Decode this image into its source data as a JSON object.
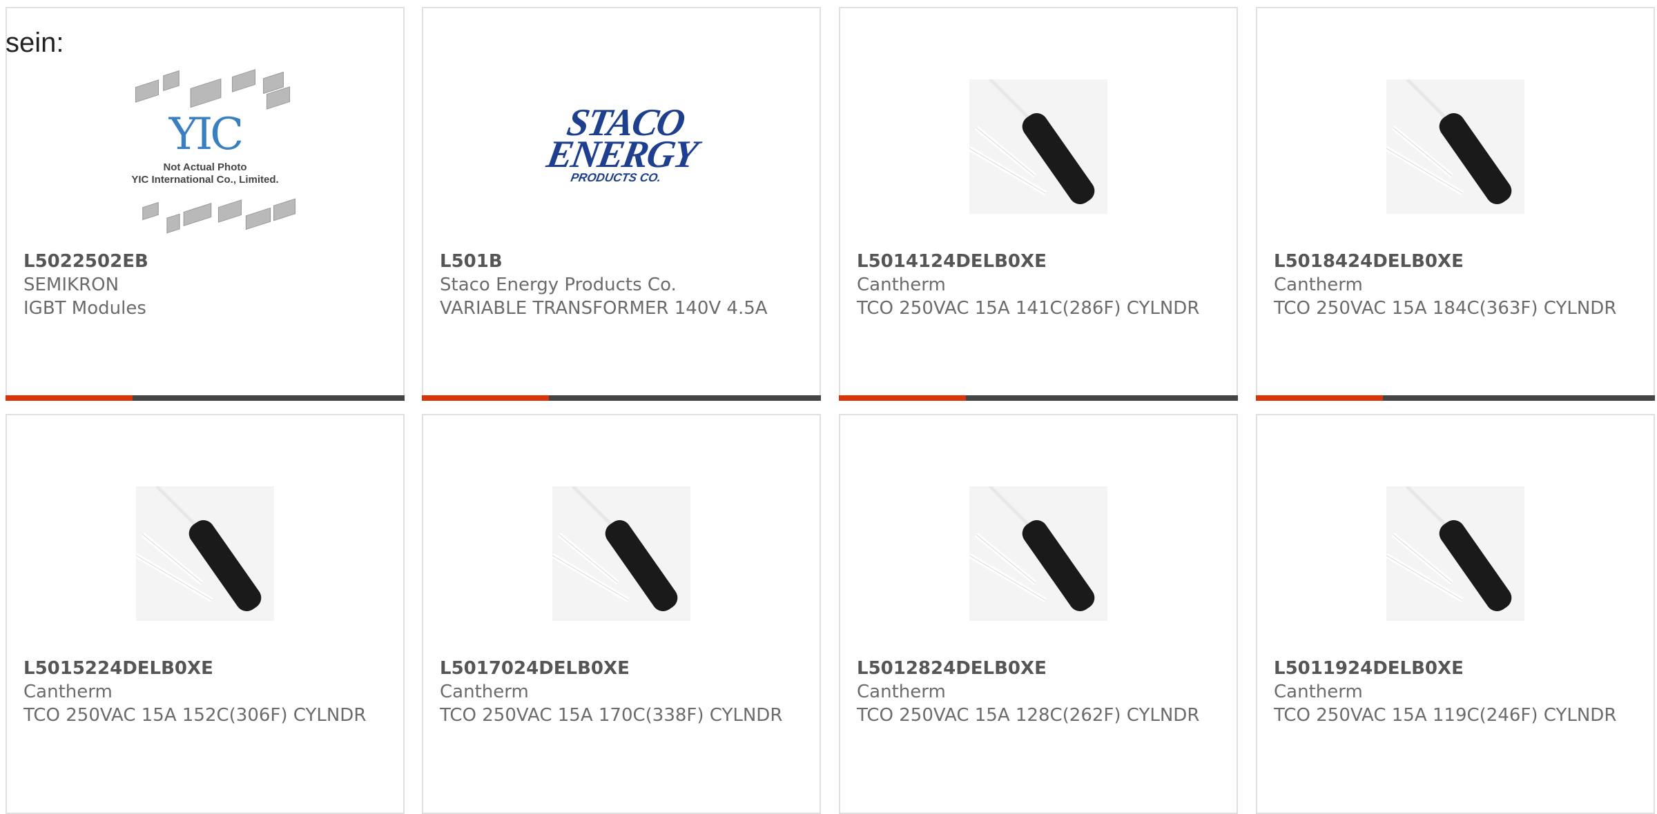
{
  "stray_text": "sein:",
  "colors": {
    "accent": "#d9350b",
    "bar": "#444444",
    "border": "#e0e0e0"
  },
  "placeholder": {
    "logo_text": "YIC",
    "note_line1": "Not Actual Photo",
    "note_line2": "YIC International Co., Limited."
  },
  "staco_logo": {
    "line1": "STACO",
    "line2": "ENERGY",
    "line3": "PRODUCTS CO."
  },
  "products": [
    {
      "part_number": "L5022502EB",
      "manufacturer": "SEMIKRON",
      "description": "IGBT Modules",
      "image": "yic-placeholder"
    },
    {
      "part_number": "L501B",
      "manufacturer": "Staco Energy Products Co.",
      "description": "VARIABLE TRANSFORMER 140V 4.5A",
      "image": "staco-logo"
    },
    {
      "part_number": "L5014124DELB0XE",
      "manufacturer": "Cantherm",
      "description": "TCO 250VAC 15A 141C(286F) CYLNDR",
      "image": "thermal-cutoff"
    },
    {
      "part_number": "L5018424DELB0XE",
      "manufacturer": "Cantherm",
      "description": "TCO 250VAC 15A 184C(363F) CYLNDR",
      "image": "thermal-cutoff"
    },
    {
      "part_number": "L5015224DELB0XE",
      "manufacturer": "Cantherm",
      "description": "TCO 250VAC 15A 152C(306F) CYLNDR",
      "image": "thermal-cutoff"
    },
    {
      "part_number": "L5017024DELB0XE",
      "manufacturer": "Cantherm",
      "description": "TCO 250VAC 15A 170C(338F) CYLNDR",
      "image": "thermal-cutoff"
    },
    {
      "part_number": "L5012824DELB0XE",
      "manufacturer": "Cantherm",
      "description": "TCO 250VAC 15A 128C(262F) CYLNDR",
      "image": "thermal-cutoff"
    },
    {
      "part_number": "L5011924DELB0XE",
      "manufacturer": "Cantherm",
      "description": "TCO 250VAC 15A 119C(246F) CYLNDR",
      "image": "thermal-cutoff"
    }
  ]
}
